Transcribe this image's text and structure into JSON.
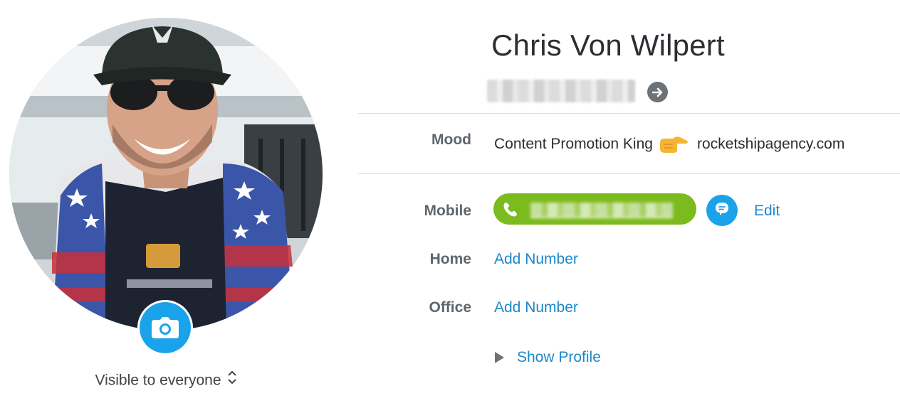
{
  "profile": {
    "name": "Chris Von Wilpert",
    "visibility_label": "Visible to everyone",
    "avatar_icon": "profile-photo",
    "camera_icon": "camera-icon",
    "go_icon": "arrow-right-circle-icon"
  },
  "mood": {
    "label": "Mood",
    "text": "Content Promotion King",
    "emoji": "pointing-right-hand-icon",
    "link_text": "rocketshipagency.com"
  },
  "phones": {
    "mobile_label": "Mobile",
    "home_label": "Home",
    "office_label": "Office",
    "add_number_label": "Add Number",
    "edit_label": "Edit",
    "call_icon": "phone-icon",
    "message_icon": "chat-bubble-icon"
  },
  "show_profile_label": "Show Profile",
  "colors": {
    "accent_blue": "#1aa3ea",
    "link_blue": "#1c87c9",
    "call_green": "#7bbb1e",
    "label_gray": "#5e666d",
    "text_dark": "#2b2f33"
  }
}
